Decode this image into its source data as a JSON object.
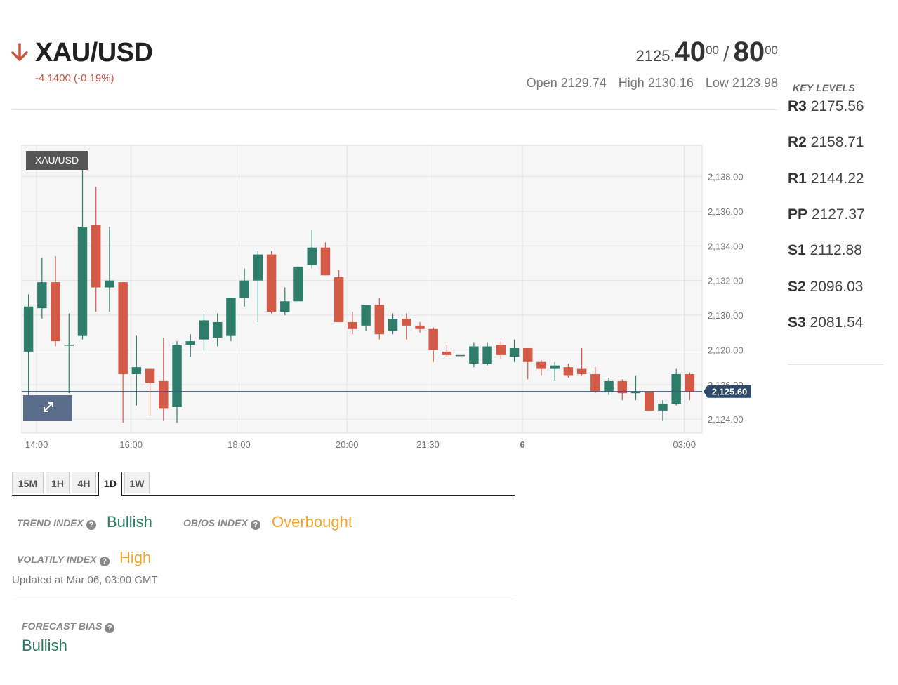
{
  "instrument": {
    "symbol": "XAU/USD",
    "change": "-4.1400 (-0.19%)",
    "direction": "down",
    "down_color": "#c9533f"
  },
  "quote": {
    "bid_prefix": "2125.",
    "bid_big": "40",
    "bid_sup": "00",
    "separator": "/",
    "ask_big": "80",
    "ask_sup": "00",
    "open": "Open 2129.74",
    "high": "High 2130.16",
    "low": "Low 2123.98"
  },
  "key_levels": {
    "title": "KEY LEVELS",
    "levels": [
      {
        "name": "R3",
        "value": "2175.56"
      },
      {
        "name": "R2",
        "value": "2158.71"
      },
      {
        "name": "R1",
        "value": "2144.22"
      },
      {
        "name": "PP",
        "value": "2127.37"
      },
      {
        "name": "S1",
        "value": "2112.88"
      },
      {
        "name": "S2",
        "value": "2096.03"
      },
      {
        "name": "S3",
        "value": "2081.54"
      }
    ]
  },
  "chart_data": {
    "type": "candlestick",
    "legend": "XAU/USD",
    "last_price": 2125.6,
    "last_price_label": "2,125.60",
    "ylim": [
      2123.2,
      2139.8
    ],
    "y_ticks": [
      {
        "value": 2124,
        "label": "2,124.00"
      },
      {
        "value": 2126,
        "label": "2,126.00"
      },
      {
        "value": 2128,
        "label": "2,128.00"
      },
      {
        "value": 2130,
        "label": "2,130.00"
      },
      {
        "value": 2132,
        "label": "2,132.00"
      },
      {
        "value": 2134,
        "label": "2,134.00"
      },
      {
        "value": 2136,
        "label": "2,136.00"
      },
      {
        "value": 2138,
        "label": "2,138.00"
      }
    ],
    "x_ticks": [
      {
        "index": 0.6,
        "label": "14:00"
      },
      {
        "index": 7.6,
        "label": "16:00"
      },
      {
        "index": 15.6,
        "label": "18:00"
      },
      {
        "index": 23.6,
        "label": "20:00"
      },
      {
        "index": 29.6,
        "label": "21:30"
      },
      {
        "index": 36.6,
        "label": "6"
      },
      {
        "index": 48.6,
        "label": "03:00"
      }
    ],
    "up_color": "#2e7d6b",
    "down_color": "#d45a48",
    "candles": [
      {
        "o": 2127.9,
        "h": 2131.2,
        "l": 2125.1,
        "c": 2130.5
      },
      {
        "o": 2130.4,
        "h": 2133.3,
        "l": 2129.8,
        "c": 2131.9
      },
      {
        "o": 2131.9,
        "h": 2133.4,
        "l": 2128.2,
        "c": 2128.5
      },
      {
        "o": 2128.3,
        "h": 2130.1,
        "l": 2125.5,
        "c": 2128.3
      },
      {
        "o": 2128.8,
        "h": 2139.4,
        "l": 2128.6,
        "c": 2135.1
      },
      {
        "o": 2135.2,
        "h": 2137.4,
        "l": 2130.2,
        "c": 2131.6
      },
      {
        "o": 2131.6,
        "h": 2135.1,
        "l": 2130.2,
        "c": 2132.0
      },
      {
        "o": 2131.9,
        "h": 2131.9,
        "l": 2123.8,
        "c": 2126.6
      },
      {
        "o": 2126.6,
        "h": 2128.8,
        "l": 2124.8,
        "c": 2127.0
      },
      {
        "o": 2126.9,
        "h": 2126.9,
        "l": 2124.2,
        "c": 2126.1
      },
      {
        "o": 2126.2,
        "h": 2128.7,
        "l": 2123.9,
        "c": 2124.6
      },
      {
        "o": 2124.7,
        "h": 2128.5,
        "l": 2123.8,
        "c": 2128.3
      },
      {
        "o": 2128.3,
        "h": 2128.9,
        "l": 2127.6,
        "c": 2128.5
      },
      {
        "o": 2128.6,
        "h": 2130.1,
        "l": 2128.0,
        "c": 2129.7
      },
      {
        "o": 2128.7,
        "h": 2130.1,
        "l": 2128.2,
        "c": 2129.6
      },
      {
        "o": 2128.8,
        "h": 2131.0,
        "l": 2128.5,
        "c": 2131.0
      },
      {
        "o": 2131.0,
        "h": 2132.7,
        "l": 2130.5,
        "c": 2132.0
      },
      {
        "o": 2132.0,
        "h": 2133.7,
        "l": 2129.6,
        "c": 2133.5
      },
      {
        "o": 2133.5,
        "h": 2133.7,
        "l": 2130.1,
        "c": 2130.2
      },
      {
        "o": 2130.2,
        "h": 2131.6,
        "l": 2130.0,
        "c": 2130.8
      },
      {
        "o": 2130.8,
        "h": 2132.8,
        "l": 2130.8,
        "c": 2132.8
      },
      {
        "o": 2132.9,
        "h": 2134.9,
        "l": 2132.7,
        "c": 2133.9
      },
      {
        "o": 2133.9,
        "h": 2134.2,
        "l": 2132.3,
        "c": 2132.3
      },
      {
        "o": 2132.2,
        "h": 2132.6,
        "l": 2129.6,
        "c": 2129.6
      },
      {
        "o": 2129.6,
        "h": 2130.2,
        "l": 2128.9,
        "c": 2129.2
      },
      {
        "o": 2129.4,
        "h": 2130.5,
        "l": 2129.1,
        "c": 2130.6
      },
      {
        "o": 2130.6,
        "h": 2131.0,
        "l": 2128.6,
        "c": 2128.9
      },
      {
        "o": 2129.1,
        "h": 2130.1,
        "l": 2128.9,
        "c": 2129.8
      },
      {
        "o": 2129.8,
        "h": 2130.1,
        "l": 2128.6,
        "c": 2129.4
      },
      {
        "o": 2129.4,
        "h": 2129.6,
        "l": 2129.0,
        "c": 2129.2
      },
      {
        "o": 2129.2,
        "h": 2129.3,
        "l": 2127.3,
        "c": 2128.0
      },
      {
        "o": 2127.9,
        "h": 2128.3,
        "l": 2127.6,
        "c": 2127.7
      },
      {
        "o": 2127.7,
        "h": 2127.7,
        "l": 2127.7,
        "c": 2127.7
      },
      {
        "o": 2127.2,
        "h": 2128.4,
        "l": 2127.0,
        "c": 2128.2
      },
      {
        "o": 2127.2,
        "h": 2128.4,
        "l": 2127.1,
        "c": 2128.2
      },
      {
        "o": 2128.3,
        "h": 2128.5,
        "l": 2127.5,
        "c": 2127.7
      },
      {
        "o": 2127.6,
        "h": 2128.6,
        "l": 2127.3,
        "c": 2128.1
      },
      {
        "o": 2128.1,
        "h": 2128.1,
        "l": 2126.3,
        "c": 2127.3
      },
      {
        "o": 2127.3,
        "h": 2127.4,
        "l": 2126.5,
        "c": 2126.9
      },
      {
        "o": 2126.9,
        "h": 2127.3,
        "l": 2126.2,
        "c": 2127.1
      },
      {
        "o": 2127.0,
        "h": 2127.2,
        "l": 2126.4,
        "c": 2126.5
      },
      {
        "o": 2126.9,
        "h": 2128.1,
        "l": 2126.5,
        "c": 2126.6
      },
      {
        "o": 2126.6,
        "h": 2127.0,
        "l": 2125.5,
        "c": 2125.6
      },
      {
        "o": 2125.6,
        "h": 2126.4,
        "l": 2125.4,
        "c": 2126.2
      },
      {
        "o": 2126.2,
        "h": 2126.3,
        "l": 2125.1,
        "c": 2125.5
      },
      {
        "o": 2125.5,
        "h": 2126.5,
        "l": 2125.1,
        "c": 2125.6
      },
      {
        "o": 2125.6,
        "h": 2125.6,
        "l": 2124.5,
        "c": 2124.5
      },
      {
        "o": 2124.5,
        "h": 2125.1,
        "l": 2123.9,
        "c": 2124.9
      },
      {
        "o": 2124.9,
        "h": 2126.9,
        "l": 2124.8,
        "c": 2126.6
      },
      {
        "o": 2126.6,
        "h": 2126.7,
        "l": 2125.1,
        "c": 2125.6
      }
    ]
  },
  "tabs": [
    "15M",
    "1H",
    "4H",
    "1D",
    "1W"
  ],
  "active_tab": "1D",
  "indexes": {
    "trend_label": "TREND INDEX",
    "trend_value": "Bullish",
    "obos_label": "OB/OS INDEX",
    "obos_value": "Overbought",
    "volatility_label": "VOLATILY INDEX",
    "volatility_value": "High",
    "question_mark": "?",
    "updated": "Updated at Mar 06, 03:00 GMT"
  },
  "forecast": {
    "label": "FORECAST BIAS",
    "value": "Bullish"
  }
}
